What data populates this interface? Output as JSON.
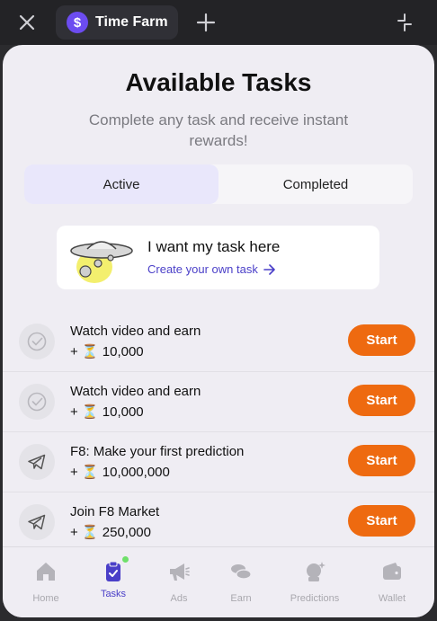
{
  "window": {
    "tab_title": "Time Farm",
    "tab_logo": "$"
  },
  "panel": {
    "title": "Available Tasks",
    "subtitle": "Complete any task and receive instant rewards!"
  },
  "segments": {
    "active_label": "Active",
    "completed_label": "Completed"
  },
  "promo": {
    "title": "I want my task here",
    "link": "Create your own task"
  },
  "tasks": [
    {
      "name": "Watch video and earn",
      "reward": "+ ⏳ 10,000",
      "icon": "check-circle-icon",
      "button": "Start"
    },
    {
      "name": "Watch video and earn",
      "reward": "+ ⏳ 10,000",
      "icon": "check-circle-icon",
      "button": "Start"
    },
    {
      "name": "F8: Make your first prediction",
      "reward": "+ ⏳ 10,000,000",
      "icon": "telegram-icon",
      "button": "Start"
    },
    {
      "name": "Join F8 Market",
      "reward": "+ ⏳ 250,000",
      "icon": "telegram-icon",
      "button": "Start"
    }
  ],
  "nav": [
    {
      "label": "Home",
      "icon": "home-icon"
    },
    {
      "label": "Tasks",
      "icon": "clipboard-check-icon",
      "active": true
    },
    {
      "label": "Ads",
      "icon": "megaphone-icon"
    },
    {
      "label": "Earn",
      "icon": "coins-icon"
    },
    {
      "label": "Predictions",
      "icon": "crystal-ball-icon"
    },
    {
      "label": "Wallet",
      "icon": "wallet-icon"
    }
  ],
  "colors": {
    "accent": "#4a3fc8",
    "start_button": "#ee6a10",
    "badge": "#6fe06a"
  }
}
